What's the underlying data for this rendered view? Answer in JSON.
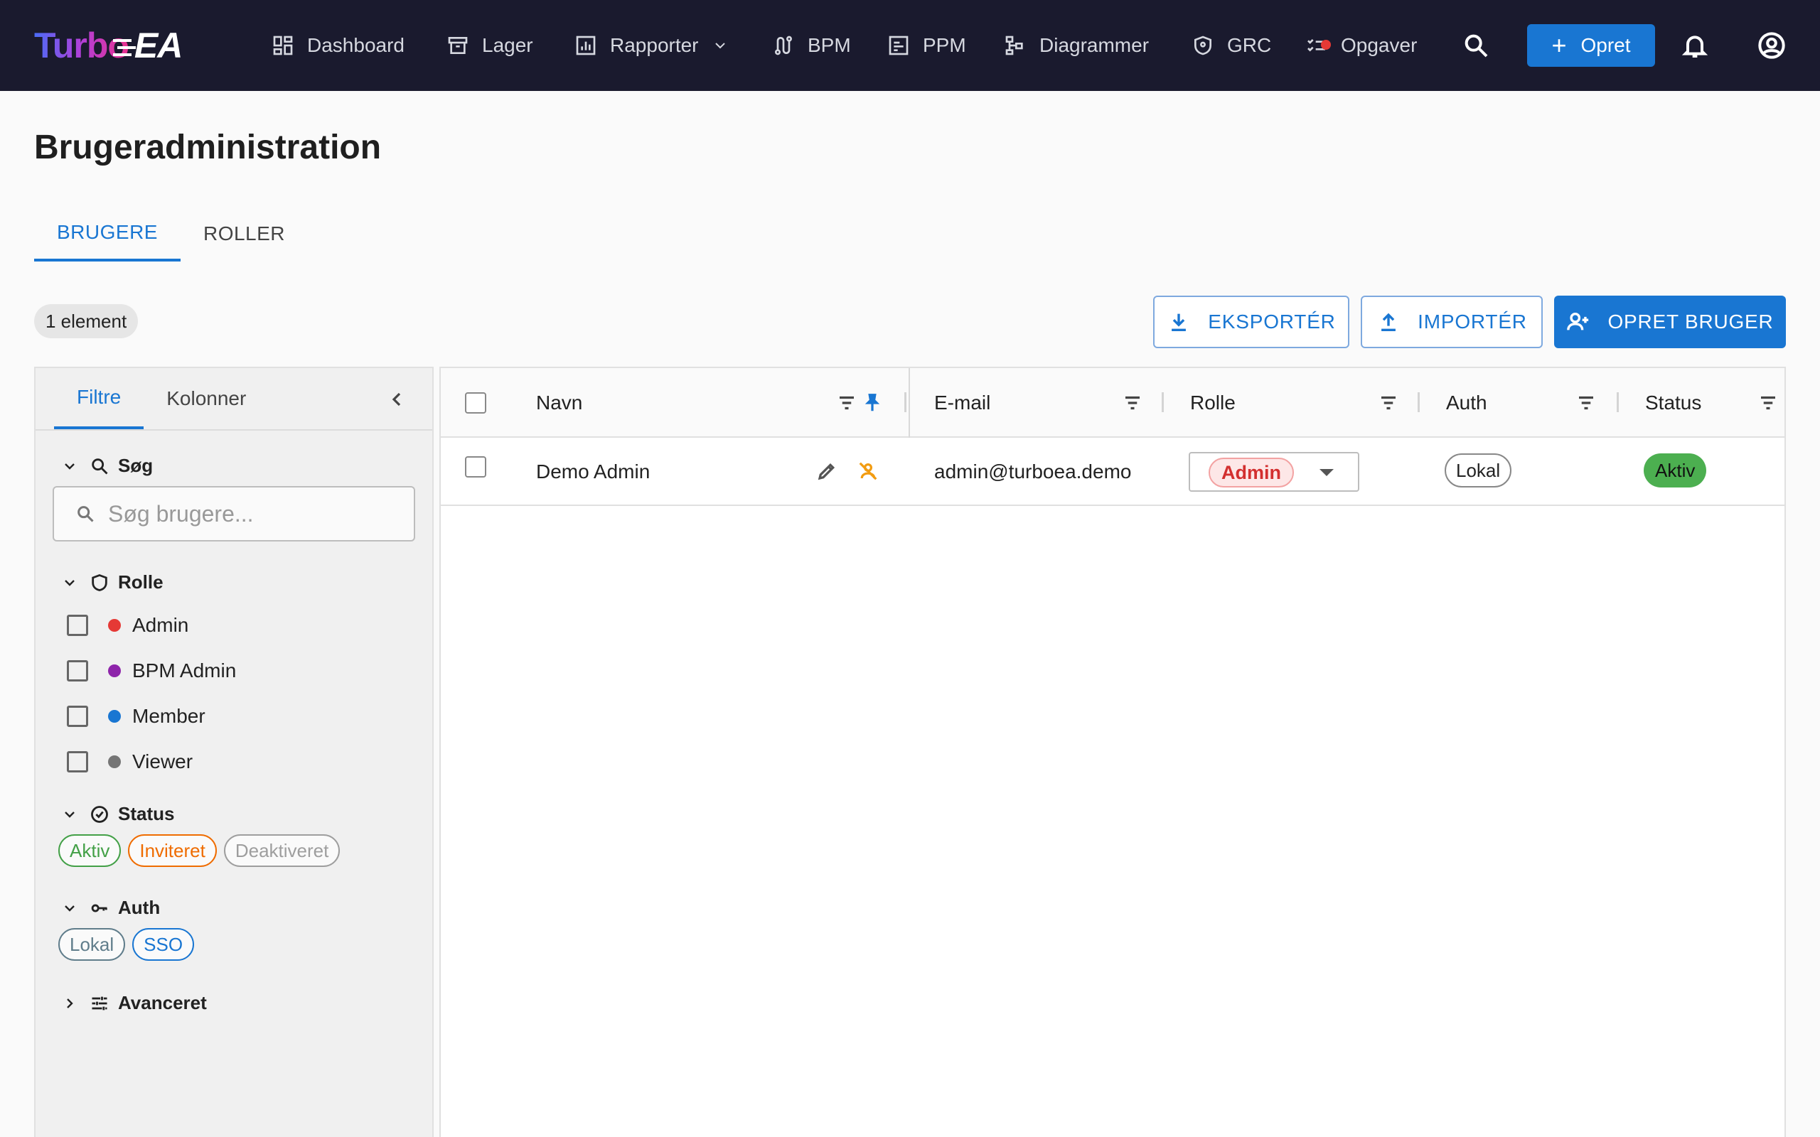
{
  "app": {
    "logo_part1": "Turbo",
    "logo_part2": "EA"
  },
  "nav": [
    {
      "label": "Dashboard",
      "icon": "dashboard-icon"
    },
    {
      "label": "Lager",
      "icon": "archive-icon"
    },
    {
      "label": "Rapporter",
      "icon": "report-icon"
    },
    {
      "label": "BPM",
      "icon": "route-icon"
    },
    {
      "label": "PPM",
      "icon": "project-icon"
    },
    {
      "label": "Diagrammer",
      "icon": "diagram-icon"
    },
    {
      "label": "GRC",
      "icon": "shield-icon"
    },
    {
      "label": "Opgaver",
      "icon": "checklist-icon"
    }
  ],
  "header": {
    "create_label": "Opret"
  },
  "page": {
    "title": "Brugeradministration"
  },
  "tabs": [
    {
      "label": "BRUGERE",
      "active": true
    },
    {
      "label": "ROLLER",
      "active": false
    }
  ],
  "toolbar": {
    "count": "1 element",
    "export_label": "EKSPORTÉR",
    "import_label": "IMPORTÉR",
    "create_user_label": "OPRET BRUGER"
  },
  "sidepanel": {
    "tabs": [
      "Filtre",
      "Kolonner"
    ],
    "search_title": "Søg",
    "search_placeholder": "Søg brugere...",
    "role_title": "Rolle",
    "roles": [
      {
        "label": "Admin",
        "color": "#e53935"
      },
      {
        "label": "BPM Admin",
        "color": "#8e24aa"
      },
      {
        "label": "Member",
        "color": "#1976d2"
      },
      {
        "label": "Viewer",
        "color": "#757575"
      }
    ],
    "status_title": "Status",
    "statuses": [
      {
        "label": "Aktiv",
        "color": "#43a047"
      },
      {
        "label": "Inviteret",
        "color": "#ef6c00"
      },
      {
        "label": "Deaktiveret",
        "color": "#9e9e9e"
      }
    ],
    "auth_title": "Auth",
    "auths": [
      {
        "label": "Lokal",
        "color": "#607d8b"
      },
      {
        "label": "SSO",
        "color": "#1976d2"
      }
    ],
    "advanced_title": "Avanceret"
  },
  "grid": {
    "columns": [
      "Navn",
      "E-mail",
      "Rolle",
      "Auth",
      "Status"
    ],
    "rows": [
      {
        "name": "Demo Admin",
        "email": "admin@turboea.demo",
        "role": "Admin",
        "auth": "Lokal",
        "status": "Aktiv"
      }
    ]
  }
}
